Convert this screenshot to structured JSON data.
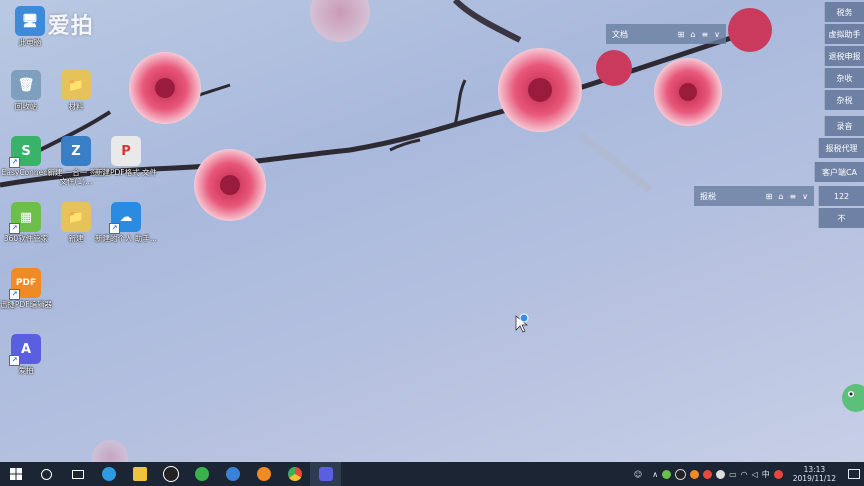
{
  "watermark": {
    "text": "爱拍"
  },
  "desktop_icons": [
    {
      "id": "computer",
      "label": "此电脑",
      "color": "#3d8ad9",
      "glyph": "🖥",
      "shortcut": false
    },
    {
      "id": "recycle-bin",
      "label": "回收站",
      "color": "#7f9fbf",
      "glyph": "🗑",
      "shortcut": false
    },
    {
      "id": "folder-1",
      "label": "材料",
      "color": "#e6c25a",
      "glyph": "📁",
      "shortcut": false
    },
    {
      "id": "easyconnect",
      "label": "EasyConnect",
      "color": "#39b26a",
      "glyph": "S",
      "shortcut": true
    },
    {
      "id": "archive",
      "label": "新建 一合一 签名文件(1)...",
      "color": "#3a7ec6",
      "glyph": "Z",
      "shortcut": false
    },
    {
      "id": "pdf-doc",
      "label": "新建PDF格式 文件",
      "color": "#e9e9e9",
      "glyph": "P",
      "shortcut": false
    },
    {
      "id": "app-store",
      "label": "360软件管家",
      "color": "#6bbf4a",
      "glyph": "▦",
      "shortcut": true
    },
    {
      "id": "folder-2",
      "label": "新建",
      "color": "#e6c25a",
      "glyph": "📁",
      "shortcut": false
    },
    {
      "id": "remote-app",
      "label": "新建的个人 助手...",
      "color": "#2b8be0",
      "glyph": "☁",
      "shortcut": true
    },
    {
      "id": "pdf-editor",
      "label": "迅捷PDF编辑器",
      "color": "#f08a24",
      "glyph": "PDF",
      "shortcut": true
    },
    {
      "id": "aipai-app",
      "label": "爱拍",
      "color": "#5a5ee0",
      "glyph": "A",
      "shortcut": true
    }
  ],
  "notes": [
    {
      "id": "note-1",
      "title": "文档",
      "controls": [
        "⊞",
        "⌂",
        "≡",
        "∨"
      ]
    },
    {
      "id": "note-2",
      "title": "报税",
      "controls": [
        "⊞",
        "⌂",
        "≡",
        "∨"
      ]
    }
  ],
  "side_tags": [
    "税务",
    "虚拟助手",
    "退税申报",
    "杂收",
    "杂税",
    "录音",
    "报税代理",
    "客户端CA",
    "122",
    "不"
  ],
  "taskbar": {
    "apps": [
      {
        "id": "start",
        "icon": "windows-icon"
      },
      {
        "id": "search",
        "icon": "cortana-icon"
      },
      {
        "id": "task-view",
        "icon": "task-view-icon"
      },
      {
        "id": "edge",
        "icon": "edge-icon",
        "color": "#2f9ae0"
      },
      {
        "id": "explorer",
        "icon": "folder-icon",
        "color": "#f0c33c"
      },
      {
        "id": "qq",
        "icon": "qq-icon",
        "color": "#222"
      },
      {
        "id": "360",
        "icon": "360-icon",
        "color": "#3cb04a"
      },
      {
        "id": "sogou",
        "icon": "sogou-icon",
        "color": "#3a82d8"
      },
      {
        "id": "browser2",
        "icon": "browser-icon",
        "color": "#f08a24"
      },
      {
        "id": "chrome",
        "icon": "chrome-icon",
        "color": "#e84b3c"
      },
      {
        "id": "aipai",
        "icon": "aipai-icon",
        "color": "#5a5ee0"
      }
    ],
    "tray": {
      "ime": "中",
      "time": "13:13",
      "date": "2019/11/12"
    }
  }
}
